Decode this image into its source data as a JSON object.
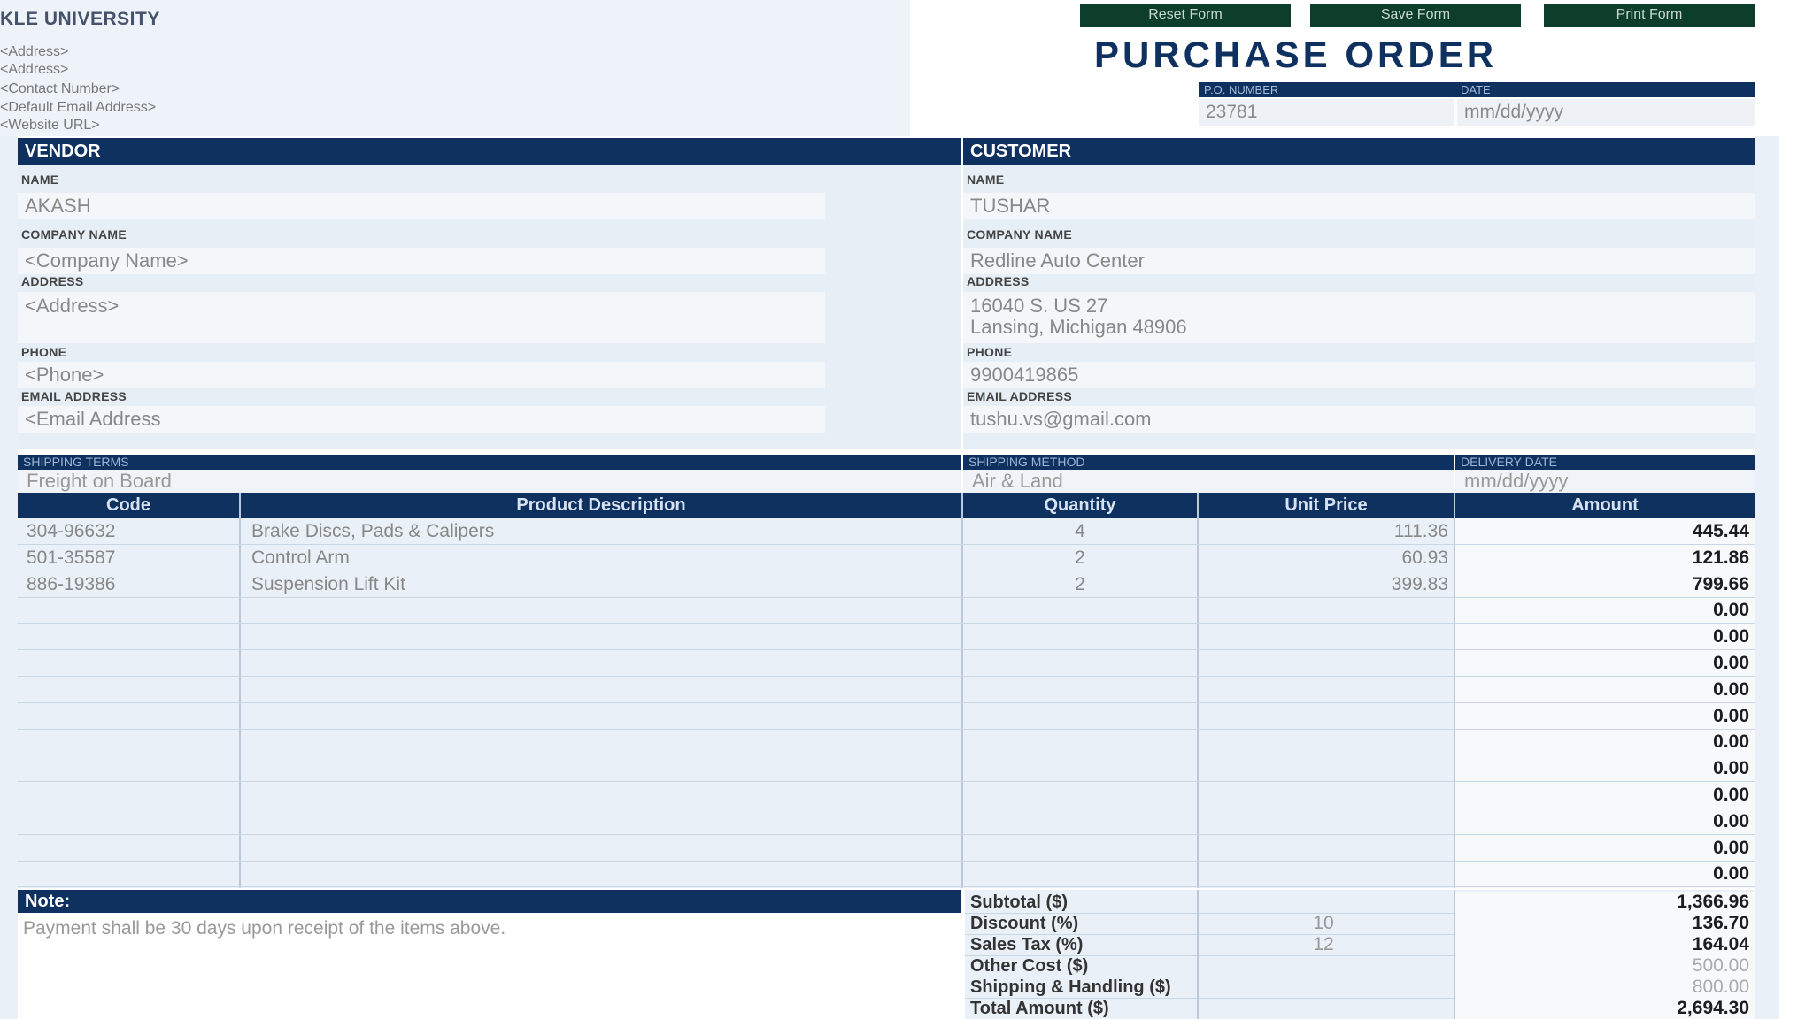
{
  "org": {
    "name": "KLE UNIVERSITY",
    "lines": [
      "<Address>",
      "<Address>",
      "<Contact Number>",
      "<Default Email Address>",
      "<Website URL>"
    ]
  },
  "buttons": {
    "reset": "Reset Form",
    "save": "Save Form",
    "print": "Print Form"
  },
  "title": "PURCHASE ORDER",
  "po": {
    "number_label": "P.O. NUMBER",
    "number": "23781",
    "date_label": "DATE",
    "date": "mm/dd/yyyy"
  },
  "vendor": {
    "header": "VENDOR",
    "name_label": "NAME",
    "name": "AKASH",
    "company_label": "COMPANY NAME",
    "company": "<Company Name>",
    "address_label": "ADDRESS",
    "address": "<Address>",
    "phone_label": "PHONE",
    "phone": "<Phone>",
    "email_label": "EMAIL ADDRESS",
    "email": "<Email Address"
  },
  "customer": {
    "header": "CUSTOMER",
    "name_label": "NAME",
    "name": "TUSHAR",
    "company_label": "COMPANY NAME",
    "company": "Redline Auto Center",
    "address_label": "ADDRESS",
    "address_line1": "16040 S. US 27",
    "address_line2": "Lansing, Michigan 48906",
    "phone_label": "PHONE",
    "phone": "9900419865",
    "email_label": "EMAIL ADDRESS",
    "email": "tushu.vs@gmail.com"
  },
  "shipping": {
    "terms_label": "SHIPPING TERMS",
    "terms": "Freight on Board",
    "method_label": "SHIPPING METHOD",
    "method": "Air & Land",
    "delivery_label": "DELIVERY DATE",
    "delivery": "mm/dd/yyyy"
  },
  "table": {
    "headers": {
      "code": "Code",
      "description": "Product Description",
      "quantity": "Quantity",
      "unit_price": "Unit Price",
      "amount": "Amount"
    },
    "rows": [
      {
        "code": "304-96632",
        "description": "Brake Discs, Pads & Calipers",
        "quantity": "4",
        "unit_price": "111.36",
        "amount": "445.44"
      },
      {
        "code": "501-35587",
        "description": "Control Arm",
        "quantity": "2",
        "unit_price": "60.93",
        "amount": "121.86"
      },
      {
        "code": "886-19386",
        "description": "Suspension Lift Kit",
        "quantity": "2",
        "unit_price": "399.83",
        "amount": "799.66"
      },
      {
        "code": "",
        "description": "",
        "quantity": "",
        "unit_price": "",
        "amount": "0.00"
      },
      {
        "code": "",
        "description": "",
        "quantity": "",
        "unit_price": "",
        "amount": "0.00"
      },
      {
        "code": "",
        "description": "",
        "quantity": "",
        "unit_price": "",
        "amount": "0.00"
      },
      {
        "code": "",
        "description": "",
        "quantity": "",
        "unit_price": "",
        "amount": "0.00"
      },
      {
        "code": "",
        "description": "",
        "quantity": "",
        "unit_price": "",
        "amount": "0.00"
      },
      {
        "code": "",
        "description": "",
        "quantity": "",
        "unit_price": "",
        "amount": "0.00"
      },
      {
        "code": "",
        "description": "",
        "quantity": "",
        "unit_price": "",
        "amount": "0.00"
      },
      {
        "code": "",
        "description": "",
        "quantity": "",
        "unit_price": "",
        "amount": "0.00"
      },
      {
        "code": "",
        "description": "",
        "quantity": "",
        "unit_price": "",
        "amount": "0.00"
      },
      {
        "code": "",
        "description": "",
        "quantity": "",
        "unit_price": "",
        "amount": "0.00"
      },
      {
        "code": "",
        "description": "",
        "quantity": "",
        "unit_price": "",
        "amount": "0.00"
      }
    ]
  },
  "note": {
    "label": "Note:",
    "text": "Payment shall be 30 days upon receipt of the items above."
  },
  "summary": {
    "subtotal_label": "Subtotal ($)",
    "subtotal": "1,366.96",
    "discount_label": "Discount (%)",
    "discount_pct": "10",
    "discount": "136.70",
    "tax_label": "Sales Tax (%)",
    "tax_pct": "12",
    "tax": "164.04",
    "other_label": "Other Cost ($)",
    "other": "500.00",
    "shipping_label": "Shipping & Handling ($)",
    "shipping": "800.00",
    "total_label": "Total Amount ($)",
    "total": "2,694.30"
  },
  "colors": {
    "navy": "#0e3160",
    "button_green": "#0d3d2b",
    "panel_blue": "#e6eef6"
  }
}
